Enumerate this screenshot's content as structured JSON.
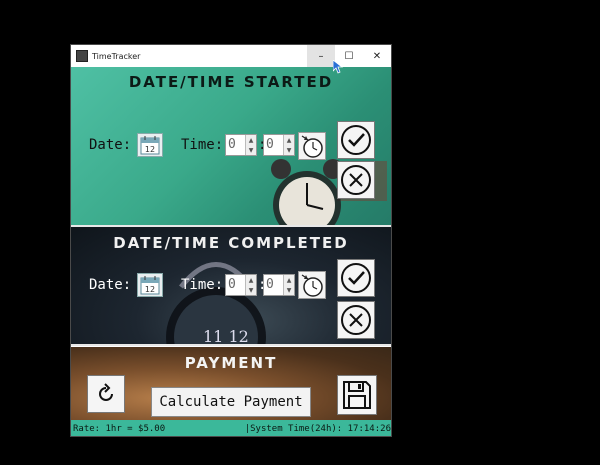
{
  "window": {
    "title": "TimeTracker",
    "controls": {
      "minimize": "–",
      "maximize": "☐",
      "close": "✕"
    }
  },
  "started": {
    "title": "Date/Time Started",
    "date_label": "Date:",
    "time_label": "Time:",
    "hours": "0",
    "minutes": "0",
    "colon": ":",
    "calendar_day": "12"
  },
  "completed": {
    "title": "Date/Time Completed",
    "date_label": "Date:",
    "time_label": "Time:",
    "hours": "0",
    "minutes": "0",
    "colon": ":",
    "calendar_day": "12"
  },
  "payment": {
    "title": "Payment",
    "calculate_label": "Calculate Payment"
  },
  "statusbar": {
    "rate": "Rate: 1hr = $5.00",
    "system_time": "|System Time(24h): 17:14:26"
  },
  "colors": {
    "started_bg": "#3aa98a",
    "completed_bg": "#1d2630",
    "payment_bg": "#7a4f2c",
    "statusbar_bg": "#3bb89a"
  },
  "icons": {
    "calendar": "calendar-icon",
    "clock": "clock-icon",
    "check": "check-icon",
    "cancel": "x-icon",
    "reset": "refresh-icon",
    "save": "floppy-disk-icon"
  }
}
